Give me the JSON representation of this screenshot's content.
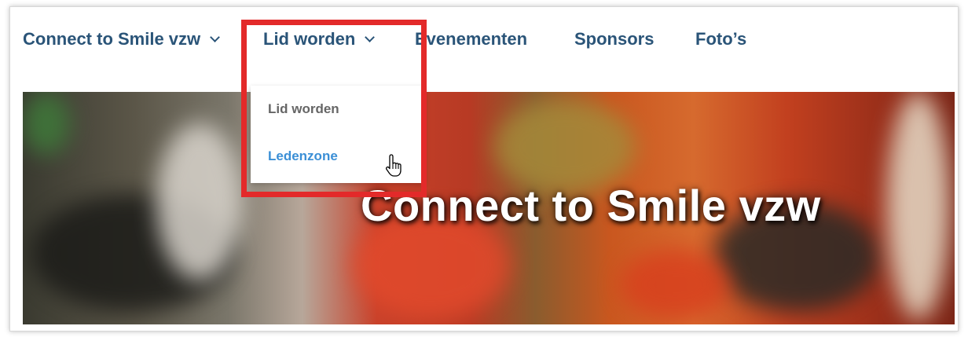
{
  "nav": {
    "items": [
      {
        "label": "Connect to Smile vzw",
        "has_dropdown": true
      },
      {
        "label": "Lid worden",
        "has_dropdown": true
      },
      {
        "label": "Evenementen",
        "has_dropdown": false
      },
      {
        "label": "Sponsors",
        "has_dropdown": false
      },
      {
        "label": "Foto’s",
        "has_dropdown": false
      }
    ]
  },
  "dropdown": {
    "items": [
      {
        "label": "Lid worden"
      },
      {
        "label": "Ledenzone"
      }
    ]
  },
  "hero": {
    "title": "Connect to Smile vzw"
  },
  "colors": {
    "nav_text": "#2a5478",
    "dropdown_muted": "#666666",
    "dropdown_link": "#3b8fd6",
    "highlight": "#e32a2a"
  },
  "icons": {
    "chevron": "chevron-down-icon",
    "cursor": "hand-pointer-icon"
  }
}
